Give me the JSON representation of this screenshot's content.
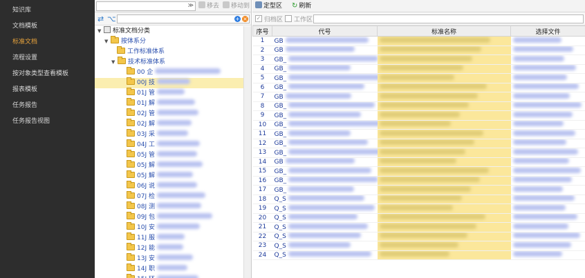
{
  "nav": {
    "items": [
      {
        "label": "知识库",
        "active": false
      },
      {
        "label": "文档模板",
        "active": false
      },
      {
        "label": "标准文档",
        "active": true
      },
      {
        "label": "流程设置",
        "active": false
      },
      {
        "label": "按对象类型查看模板",
        "active": false
      },
      {
        "label": "报表模板",
        "active": false
      },
      {
        "label": "任务报告",
        "active": false
      },
      {
        "label": "任务报告视图",
        "active": false
      }
    ]
  },
  "tree": {
    "root": "标准文档分类",
    "level1": "按体系分",
    "work_system": "工作标准体系",
    "tech_system": "技术标准体系",
    "nodes": [
      "00 企",
      "00J 技",
      "01J 管",
      "01J 解",
      "02J 管",
      "02J 解",
      "03J 采",
      "04J 工",
      "05J 管",
      "05J 解",
      "05J 解",
      "06J 说",
      "07J 检",
      "08J 测",
      "09J 包",
      "10J 安",
      "11J 服",
      "12J 能",
      "13J 安",
      "14J 职",
      "15J 环"
    ],
    "selected_index": 1
  },
  "toolbar": {
    "move_label": "移去",
    "move_to_label": "移动到",
    "fixed_area_label": "定型区",
    "refresh_label": "刷新"
  },
  "filter": {
    "archive_label": "归档区",
    "work_label": "工作区"
  },
  "grid": {
    "headers": [
      "序号",
      "代号",
      "标准名称",
      "选择文件"
    ],
    "rows": [
      {
        "no": "1",
        "code": "GB"
      },
      {
        "no": "2",
        "code": "GB"
      },
      {
        "no": "3",
        "code": "GB_"
      },
      {
        "no": "4",
        "code": "GB_"
      },
      {
        "no": "5",
        "code": "GB_"
      },
      {
        "no": "6",
        "code": "GB_"
      },
      {
        "no": "7",
        "code": "GB"
      },
      {
        "no": "8",
        "code": "GB_"
      },
      {
        "no": "9",
        "code": "GB_"
      },
      {
        "no": "10",
        "code": "GB_"
      },
      {
        "no": "11",
        "code": "GB_"
      },
      {
        "no": "12",
        "code": "GB_"
      },
      {
        "no": "13",
        "code": "GB_"
      },
      {
        "no": "14",
        "code": "GB"
      },
      {
        "no": "15",
        "code": "GB_"
      },
      {
        "no": "16",
        "code": "GB_"
      },
      {
        "no": "17",
        "code": "GB_"
      },
      {
        "no": "18",
        "code": "Q_S"
      },
      {
        "no": "19",
        "code": "Q_S"
      },
      {
        "no": "20",
        "code": "Q_S"
      },
      {
        "no": "21",
        "code": "Q_S"
      },
      {
        "no": "22",
        "code": "Q_S"
      },
      {
        "no": "23",
        "code": "Q_S"
      },
      {
        "no": "24",
        "code": "Q_S"
      }
    ]
  },
  "colors": {
    "nav_bg": "#2d2d2d",
    "nav_active": "#e8a33c",
    "selected_row": "#fbeeb0",
    "name_column": "#fbe79b"
  }
}
